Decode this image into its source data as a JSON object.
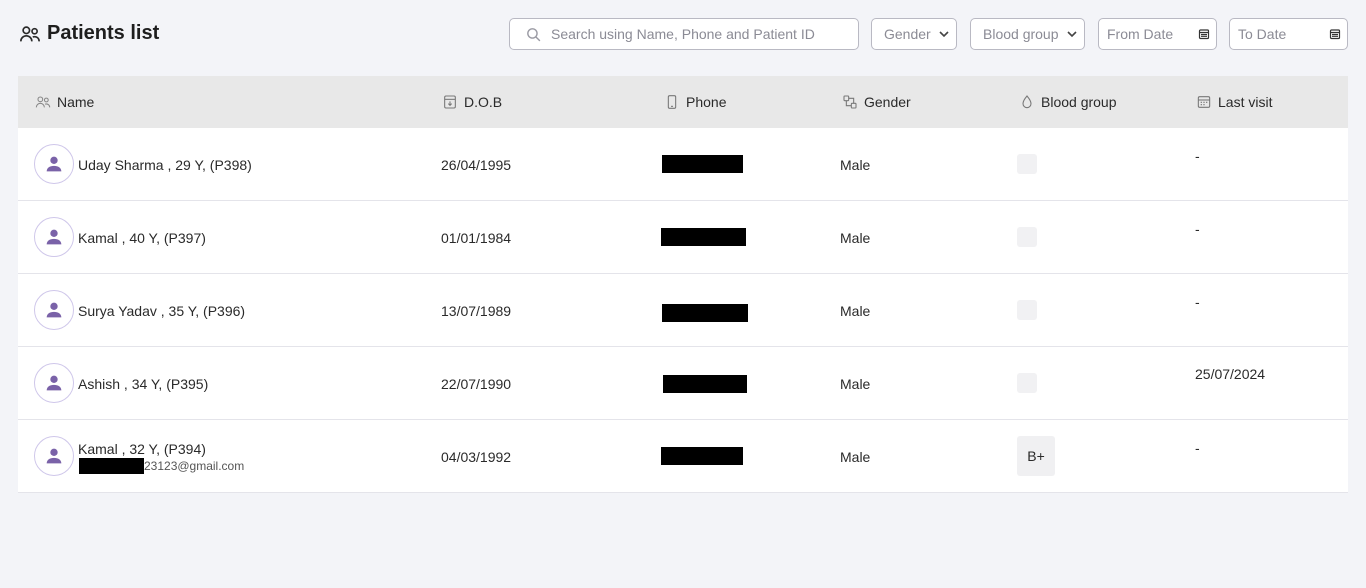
{
  "header": {
    "title": "Patients list",
    "search_placeholder": "Search using Name, Phone and Patient ID",
    "gender_filter": "Gender",
    "blood_group_filter": "Blood group",
    "from_date_placeholder": "From Date",
    "to_date_placeholder": "To Date"
  },
  "table": {
    "columns": {
      "name": "Name",
      "dob": "D.O.B",
      "phone": "Phone",
      "gender": "Gender",
      "blood_group": "Blood group",
      "last_visit": "Last visit"
    },
    "rows": [
      {
        "name": "Uday Sharma , 29 Y, (P398)",
        "dob": "26/04/1995",
        "gender": "Male",
        "blood_group": "",
        "last_visit": "-"
      },
      {
        "name": "Kamal , 40 Y, (P397)",
        "dob": "01/01/1984",
        "gender": "Male",
        "blood_group": "",
        "last_visit": "-"
      },
      {
        "name": "Surya Yadav , 35 Y, (P396)",
        "dob": "13/07/1989",
        "gender": "Male",
        "blood_group": "",
        "last_visit": "-"
      },
      {
        "name": "Ashish , 34 Y, (P395)",
        "dob": "22/07/1990",
        "gender": "Male",
        "blood_group": "",
        "last_visit": "25/07/2024"
      },
      {
        "name": "Kamal , 32 Y, (P394)",
        "email_suffix": "23123@gmail.com",
        "dob": "04/03/1992",
        "gender": "Male",
        "blood_group": "B+",
        "last_visit": "-"
      }
    ]
  },
  "colors": {
    "accent": "#7a62a8",
    "header_bg": "#e8e8e8",
    "page_bg": "#f3f4f8"
  }
}
